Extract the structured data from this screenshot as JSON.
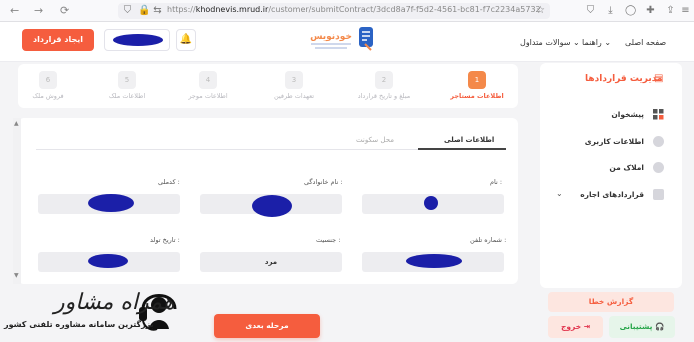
{
  "browser": {
    "url_prefix": "https://",
    "url_domain": "khodnevis.mrud.ir",
    "url_path": "/customer/submitContract/3dcd8a7f-f5d2-4561-bc81-f7c2234a5732"
  },
  "header": {
    "create_contract": "ایجاد قرارداد",
    "nav": [
      "صفحه اصلی",
      "راهنما",
      "سوالات متداول"
    ],
    "logo_text": "خودنویس"
  },
  "sidebar": {
    "title": "مدیریت قراردادها",
    "items": [
      {
        "label": "پیشخوان",
        "icon": "grid-icon"
      },
      {
        "label": "اطلاعات کاربری",
        "icon": "user-icon"
      },
      {
        "label": "املاک من",
        "icon": "house-icon"
      },
      {
        "label": "قراردادهای اجاره",
        "icon": "document-icon"
      }
    ],
    "report": "گزارش خطا",
    "support": "پشتیبانی",
    "exit": "خروج"
  },
  "steps": [
    {
      "num": "1",
      "name": "اطلاعات مستاجر",
      "active": true
    },
    {
      "num": "2",
      "name": "مبلغ و تاریخ قرارداد",
      "active": false
    },
    {
      "num": "3",
      "name": "تعهدات طرفین",
      "active": false
    },
    {
      "num": "4",
      "name": "اطلاعات موجر",
      "active": false
    },
    {
      "num": "5",
      "name": "اطلاعات ملک",
      "active": false
    },
    {
      "num": "6",
      "name": "فروش ملک",
      "active": false
    }
  ],
  "tabs": {
    "main": "اطلاعات اصلی",
    "residence": "محل سکونت"
  },
  "form": {
    "name_label": "نام :",
    "family_label": "نام خانوادگی :",
    "national_code_label": "کدملی :",
    "phone_label": "شماره تلفن :",
    "gender_label": "جنسیت :",
    "gender_value": "مرد",
    "birth_label": "تاریخ تولد :"
  },
  "next_step": "مرحله بعدی",
  "watermark": {
    "title": "همراه مشاور",
    "subtitle": "بزرگترین سامانه مشاوره تلفنی کشور"
  },
  "colors": {
    "accent": "#f55d3e",
    "active_step": "#f4894a",
    "support_green": "#27a64a",
    "redaction": "#1b1fa8"
  }
}
